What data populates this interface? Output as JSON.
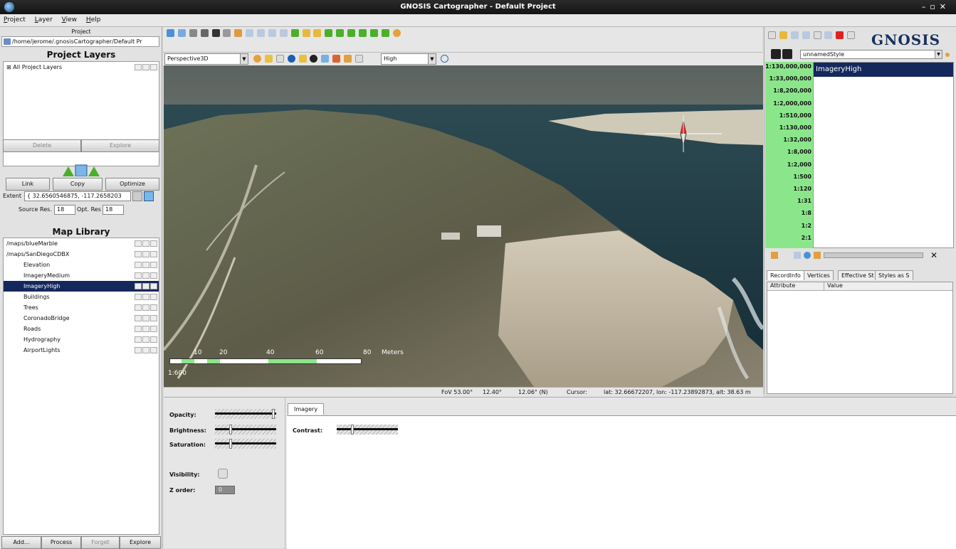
{
  "window": {
    "title": "GNOSIS Cartographer - Default Project"
  },
  "menu": [
    "Project",
    "Layer",
    "View",
    "Help"
  ],
  "project": {
    "header": "Project",
    "path": "/home/jerome/.gnosisCartographer/Default Pr",
    "layers_title": "Project Layers",
    "layers": [
      "All Project Layers"
    ],
    "delete_label": "Delete",
    "explore_label": "Explore"
  },
  "link_panel": {
    "link_label": "Link",
    "copy_label": "Copy",
    "optimize_label": "Optimize",
    "extent_label": "Extent",
    "extent_value": "{ 32.6560546875, -117.2658203",
    "source_res_label": "Source Res.",
    "source_res_value": "18",
    "opt_res_label": "Opt. Res",
    "opt_res_value": "18"
  },
  "library": {
    "title": "Map Library",
    "items": [
      {
        "label": "/maps/blueMarble",
        "indent": 0
      },
      {
        "label": "/maps/SanDiegoCDBX",
        "indent": 0
      },
      {
        "label": "Elevation",
        "indent": 1
      },
      {
        "label": "ImageryMedium",
        "indent": 1
      },
      {
        "label": "ImageryHigh",
        "indent": 1,
        "selected": true
      },
      {
        "label": "Buildings",
        "indent": 1
      },
      {
        "label": "Trees",
        "indent": 1
      },
      {
        "label": "CoronadoBridge",
        "indent": 1
      },
      {
        "label": "Roads",
        "indent": 1
      },
      {
        "label": "Hydrography",
        "indent": 1
      },
      {
        "label": "AirportLights",
        "indent": 1
      }
    ],
    "buttons": [
      "Add...",
      "Process",
      "Forget",
      "Explore"
    ]
  },
  "viewbar": {
    "projection": "Perspective3D",
    "quality": "High"
  },
  "map": {
    "scale_ticks": [
      "10",
      "20",
      "40",
      "60",
      "80",
      "Meters"
    ],
    "scale_ratio": "1:600"
  },
  "status": {
    "fov": "FoV 53.00°",
    "tilt": "12.40°",
    "heading": "12.06° (N)",
    "cursor_label": "Cursor:",
    "coords": "lat: 32.66672207, lon: -117.23892873, alt: 38.63 m"
  },
  "style": {
    "logo": "GNOSIS",
    "name": "unnamedStyle",
    "scales": [
      "1:130,000,000",
      "1:33,000,000",
      "1:8,200,000",
      "1:2,000,000",
      "1:510,000",
      "1:130,000",
      "1:32,000",
      "1:8,000",
      "1:2,000",
      "1:500",
      "1:120",
      "1:31",
      "1:8",
      "1:2",
      "2:1"
    ],
    "selected_layer": "ImageryHigh"
  },
  "info_tabs": [
    "RecordInfo",
    "Vertices",
    "Effective St",
    "Styles as S"
  ],
  "info_cols": [
    "Attribute",
    "Value"
  ],
  "props": {
    "opacity_label": "Opacity:",
    "brightness_label": "Brightness:",
    "saturation_label": "Saturation:",
    "visibility_label": "Visibility:",
    "zorder_label": "Z order:",
    "zorder_value": "0",
    "tab_label": "Imagery",
    "contrast_label": "Contrast:",
    "opacity": 1.0,
    "brightness": 0.25,
    "saturation": 0.25,
    "contrast": 0.25
  }
}
